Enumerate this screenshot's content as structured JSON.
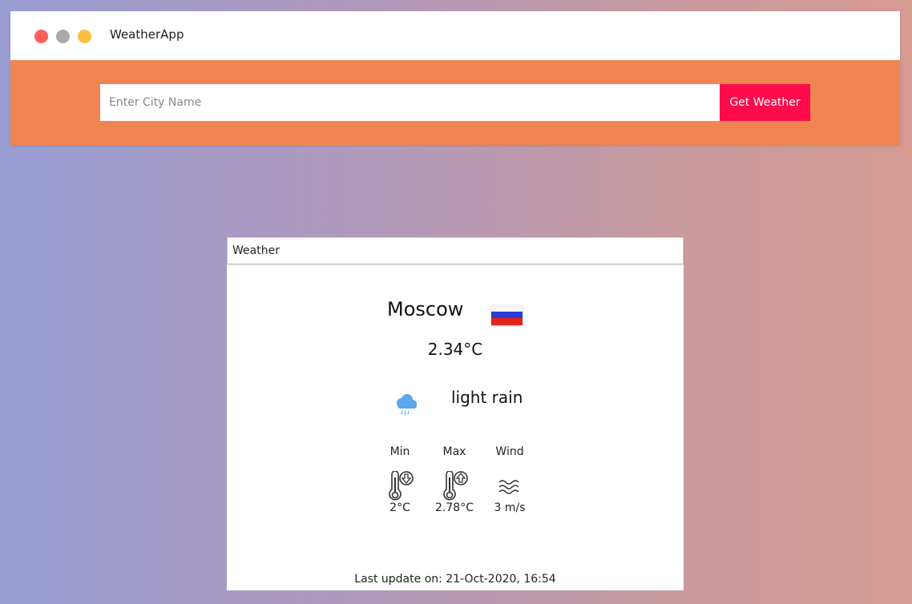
{
  "app": {
    "title": "WeatherApp"
  },
  "search": {
    "placeholder": "Enter City Name",
    "value": "",
    "button_label": "Get Weather"
  },
  "card": {
    "header": "Weather",
    "city": "Moscow",
    "flag_icon": "russia-flag-icon",
    "temperature": "2.34°C",
    "condition_icon": "cloud-rain-icon",
    "description": "light rain",
    "stats": {
      "min": {
        "label": "Min",
        "value": "2°C",
        "icon": "thermometer-down-icon"
      },
      "max": {
        "label": "Max",
        "value": "2.78°C",
        "icon": "thermometer-up-icon"
      },
      "wind": {
        "label": "Wind",
        "value": "3 m/s",
        "icon": "wind-icon"
      }
    },
    "last_update": "Last update on: 21-Oct-2020, 16:54"
  },
  "colors": {
    "header_band": "#f08552",
    "button": "#ff0b4c",
    "close_dot": "#fd5f58",
    "minimize_dot": "#a9a9a9",
    "maximize_dot": "#fdbd42",
    "rain_icon": "#5aa6e8"
  }
}
